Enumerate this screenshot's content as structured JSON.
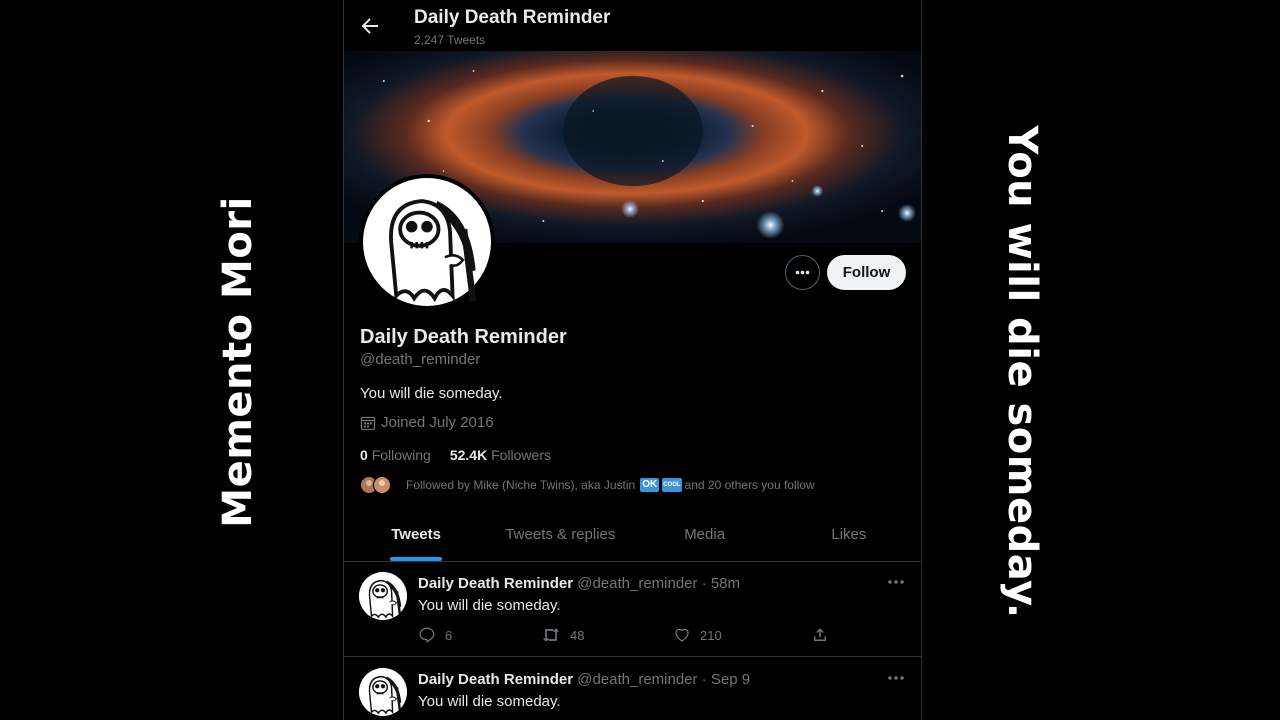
{
  "overlay": {
    "left_text": "Memento Mori",
    "right_text": "You will die someday."
  },
  "header": {
    "title": "Daily Death Reminder",
    "tweet_count": "2,247 Tweets"
  },
  "profile": {
    "name": "Daily Death Reminder",
    "handle": "@death_reminder",
    "bio": "You will die someday.",
    "joined": "Joined July 2016",
    "following_count": "0",
    "following_label": "Following",
    "followers_count": "52.4K",
    "followers_label": "Followers",
    "followed_by_prefix": "Followed by Mike (Niche Twins), aka Justin",
    "ok_badge": "OK",
    "cool_badge": "COOL",
    "followed_by_suffix": "and 20 others you follow",
    "follow_label": "Follow"
  },
  "tabs": [
    {
      "label": "Tweets",
      "active": true
    },
    {
      "label": "Tweets & replies",
      "active": false
    },
    {
      "label": "Media",
      "active": false
    },
    {
      "label": "Likes",
      "active": false
    }
  ],
  "tweets": [
    {
      "name": "Daily Death Reminder",
      "meta": "@death_reminder · 58m",
      "text": "You will die someday.",
      "replies": "6",
      "retweets": "48",
      "likes": "210"
    },
    {
      "name": "Daily Death Reminder",
      "meta": "@death_reminder · Sep 9",
      "text": "You will die someday."
    }
  ],
  "colors": {
    "background": "#000000",
    "accent": "#1d9bf0",
    "muted": "#71767b",
    "text": "#e7e9ea"
  },
  "icons": [
    "back-arrow-icon",
    "calendar-icon",
    "more-icon",
    "reply-icon",
    "retweet-icon",
    "like-icon",
    "share-icon"
  ]
}
